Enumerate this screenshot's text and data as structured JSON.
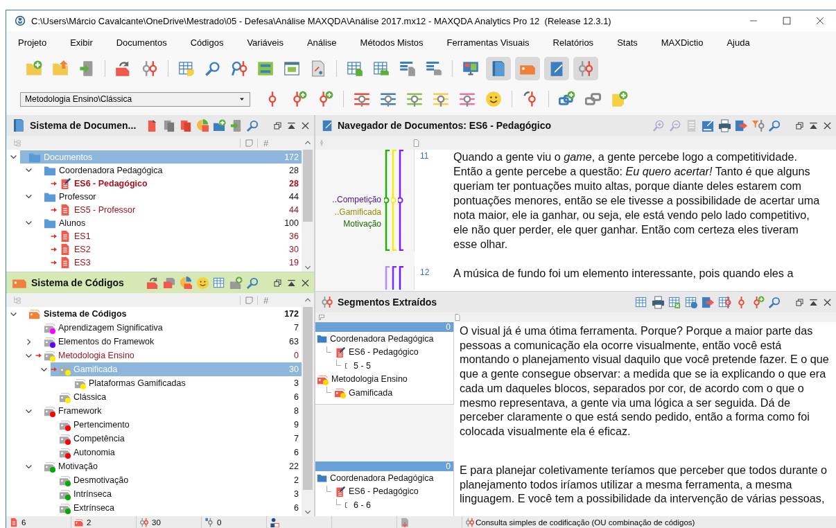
{
  "window": {
    "title": "C:\\Users\\Márcio Cavalcante\\OneDrive\\Mestrado\\05 - Defesa\\Análise MAXQDA\\Análise 2017.mx12 - MAXQDA Analytics Pro 12  (Release 12.3.1)"
  },
  "menu": [
    "Projeto",
    "Exibir",
    "Documentos",
    "Códigos",
    "Variáveis",
    "Análise",
    "Métodos Mistos",
    "Ferramentas Visuais",
    "Relatórios",
    "Stats",
    "MAXDictio",
    "Ajuda"
  ],
  "toolbar": {
    "window_toggles": [
      {
        "on": true
      },
      {
        "on": true
      },
      {
        "on": true
      },
      {
        "on": true
      }
    ],
    "code_selector": {
      "value": "Metodologia Ensino\\Clássica"
    }
  },
  "documents_panel": {
    "title": "Sistema de Documen...",
    "count_heading": "#",
    "tree": [
      {
        "kind": "folder",
        "label": "Documentos",
        "count": "172",
        "expanded": true,
        "selected": true,
        "activated": false,
        "opened": false,
        "children": [
          {
            "kind": "folder",
            "label": "Coordenadora Pedagógica",
            "count": "28",
            "expanded": true,
            "selected": false,
            "activated": false,
            "opened": false,
            "children": [
              {
                "kind": "document-memo",
                "label": "ES6 - Pedagógico",
                "count": "28",
                "selected": false,
                "activated": true,
                "opened": true
              }
            ]
          },
          {
            "kind": "folder",
            "label": "Professor",
            "count": "44",
            "expanded": true,
            "selected": false,
            "activated": false,
            "opened": false,
            "children": [
              {
                "kind": "document",
                "label": "ES5 - Professor",
                "count": "44",
                "selected": false,
                "activated": true,
                "opened": false
              }
            ]
          },
          {
            "kind": "folder",
            "label": "Alunos",
            "count": "100",
            "expanded": true,
            "selected": false,
            "activated": false,
            "opened": false,
            "children": [
              {
                "kind": "document",
                "label": "ES1",
                "count": "36",
                "selected": false,
                "activated": true,
                "opened": false
              },
              {
                "kind": "document",
                "label": "ES2",
                "count": "30",
                "selected": false,
                "activated": true,
                "opened": false
              },
              {
                "kind": "document",
                "label": "ES3",
                "count": "19",
                "selected": false,
                "activated": true,
                "opened": false
              }
            ]
          }
        ]
      }
    ]
  },
  "codes_panel": {
    "title": "Sistema de Códigos",
    "count_heading": "#",
    "tree": [
      {
        "kind": "root",
        "label": "Sistema de Códigos",
        "count": "172",
        "expanded": true,
        "selected": false,
        "activated": false,
        "children": [
          {
            "kind": "code",
            "label": "Aprendizagem Significativa",
            "count": "7",
            "color": "#ff00ff",
            "selected": false,
            "activated": false
          },
          {
            "kind": "code",
            "label": "Elementos do Framewok",
            "count": "63",
            "color": "#5a00ff",
            "expanded": false,
            "selected": false,
            "activated": false
          },
          {
            "kind": "code",
            "label": "Metodologia Ensino",
            "count": "0",
            "color": "#ffee00",
            "expanded": true,
            "selected": false,
            "activated": true,
            "children": [
              {
                "kind": "code",
                "label": "Gamificada",
                "count": "30",
                "color": "#ffee00",
                "expanded": true,
                "selected": true,
                "activated": true,
                "children": [
                  {
                    "kind": "code",
                    "label": "Plataformas Gamificadas",
                    "count": "3",
                    "color": "#ffee00",
                    "selected": false,
                    "activated": false
                  }
                ]
              },
              {
                "kind": "code",
                "label": "Clássica",
                "count": "6",
                "color": "#ffee00",
                "selected": false,
                "activated": false
              }
            ]
          },
          {
            "kind": "code",
            "label": "Framework",
            "count": "8",
            "color": "#ff0000",
            "expanded": true,
            "selected": false,
            "activated": false,
            "children": [
              {
                "kind": "code",
                "label": "Pertencimento",
                "count": "9",
                "color": "#ff0000",
                "selected": false,
                "activated": false
              },
              {
                "kind": "code",
                "label": "Competência",
                "count": "7",
                "color": "#ff0000",
                "selected": false,
                "activated": false
              },
              {
                "kind": "code",
                "label": "Autonomia",
                "count": "6",
                "color": "#ff0000",
                "selected": false,
                "activated": false
              }
            ]
          },
          {
            "kind": "code",
            "label": "Motivação",
            "count": "22",
            "color": "#00aa00",
            "expanded": true,
            "selected": false,
            "activated": false,
            "children": [
              {
                "kind": "code",
                "label": "Desmotivação",
                "count": "2",
                "color": "#00aa00",
                "selected": false,
                "activated": false
              },
              {
                "kind": "code",
                "label": "Intrínseca",
                "count": "3",
                "color": "#00aa00",
                "selected": false,
                "activated": false
              },
              {
                "kind": "code",
                "label": "Extrínseca",
                "count": "6",
                "color": "#00aa00",
                "selected": false,
                "activated": false
              }
            ]
          }
        ]
      }
    ]
  },
  "document_browser": {
    "title": "Navegador de Documentos: ES6 - Pedagógico",
    "paragraphs": [
      {
        "number": "11",
        "text": "Quando a gente viu o *game*, a gente percebe logo a competitividade. Então a gente percebe a questão: *Eu quero acertar!* Tanto é que alguns queriam ter pontuações muito altas, porque diante deles estarem com pontuações menores, então se ele tivesse a possibilidade de acertar uma nota maior, ele ia ganhar, ou seja, ele está vendo pelo lado competitivo, ele não quer perder, ele quer ganhar. Então com certeza eles tiveram esse olhar.",
        "stripes": [
          {
            "label": "..Competição",
            "color": "#7a1fff"
          },
          {
            "label": "..Gamificada",
            "color": "#f5ee00"
          },
          {
            "label": "Motivação",
            "color": "#22b000"
          }
        ]
      },
      {
        "number": "12",
        "text": "A música de fundo foi um elemento interessante, pois quando eles a",
        "stripes": [
          {
            "color": "#6a1cff"
          },
          {
            "color": "#7a2dff"
          },
          {
            "color": "#b58cff"
          }
        ]
      }
    ]
  },
  "retrieved_segments": {
    "title": "Segmentos Extraídos",
    "segments": [
      {
        "weight": "0",
        "sources": [
          {
            "kind": "folder",
            "label": "Coordenadora Pedagógica",
            "children": [
              {
                "kind": "document",
                "label": "ES6 - Pedagógico",
                "children": [
                  {
                    "kind": "range",
                    "label": "5 - 5"
                  }
                ]
              }
            ]
          },
          {
            "kind": "code",
            "label": "Metodologia Ensino",
            "color": "#ffd800",
            "children": [
              {
                "kind": "code",
                "label": "Gamificada",
                "color": "#ffd800"
              }
            ]
          }
        ],
        "text": "O visual já é uma ótima ferramenta. Porque? Porque a maior parte das pessoas a comunicação ela ocorre visualmente, então você está montando o planejamento visual daquilo que você pretende fazer. E o que que a gente consegue observar: a medida que se ia explicando o que era cada um daqueles blocos, separados por cor, de acordo com o que o mesmo representava, a gente via uma lógica a ser seguida. Dá de perceber claramente o que está sendo pedido, então a forma como foi colocada visualmente ela é eficaz."
      },
      {
        "weight": "0",
        "sources": [
          {
            "kind": "folder",
            "label": "Coordenadora Pedagógica",
            "children": [
              {
                "kind": "document",
                "label": "ES6 - Pedagógico",
                "children": [
                  {
                    "kind": "range",
                    "label": "6 - 6"
                  }
                ]
              }
            ]
          }
        ],
        "text": "E para planejar coletivamente teríamos que perceber que todos durante o planejamento todos iríamos utilizar a mesma ferramenta, a mesma linguagem. E você tem a possibilidade da intervenção de várias pessoas,"
      }
    ]
  },
  "status_bar": [
    {
      "kind": "documents",
      "count": "6"
    },
    {
      "kind": "codes",
      "count": "2"
    },
    {
      "kind": "segments",
      "count": "30"
    },
    {
      "kind": "variables",
      "count": "0"
    },
    {
      "kind": "user"
    },
    {
      "kind": "blank"
    },
    {
      "kind": "document-arrow"
    },
    {
      "kind": "query",
      "text": "Consulta simples de codificação (OU combinação de códigos)"
    }
  ]
}
